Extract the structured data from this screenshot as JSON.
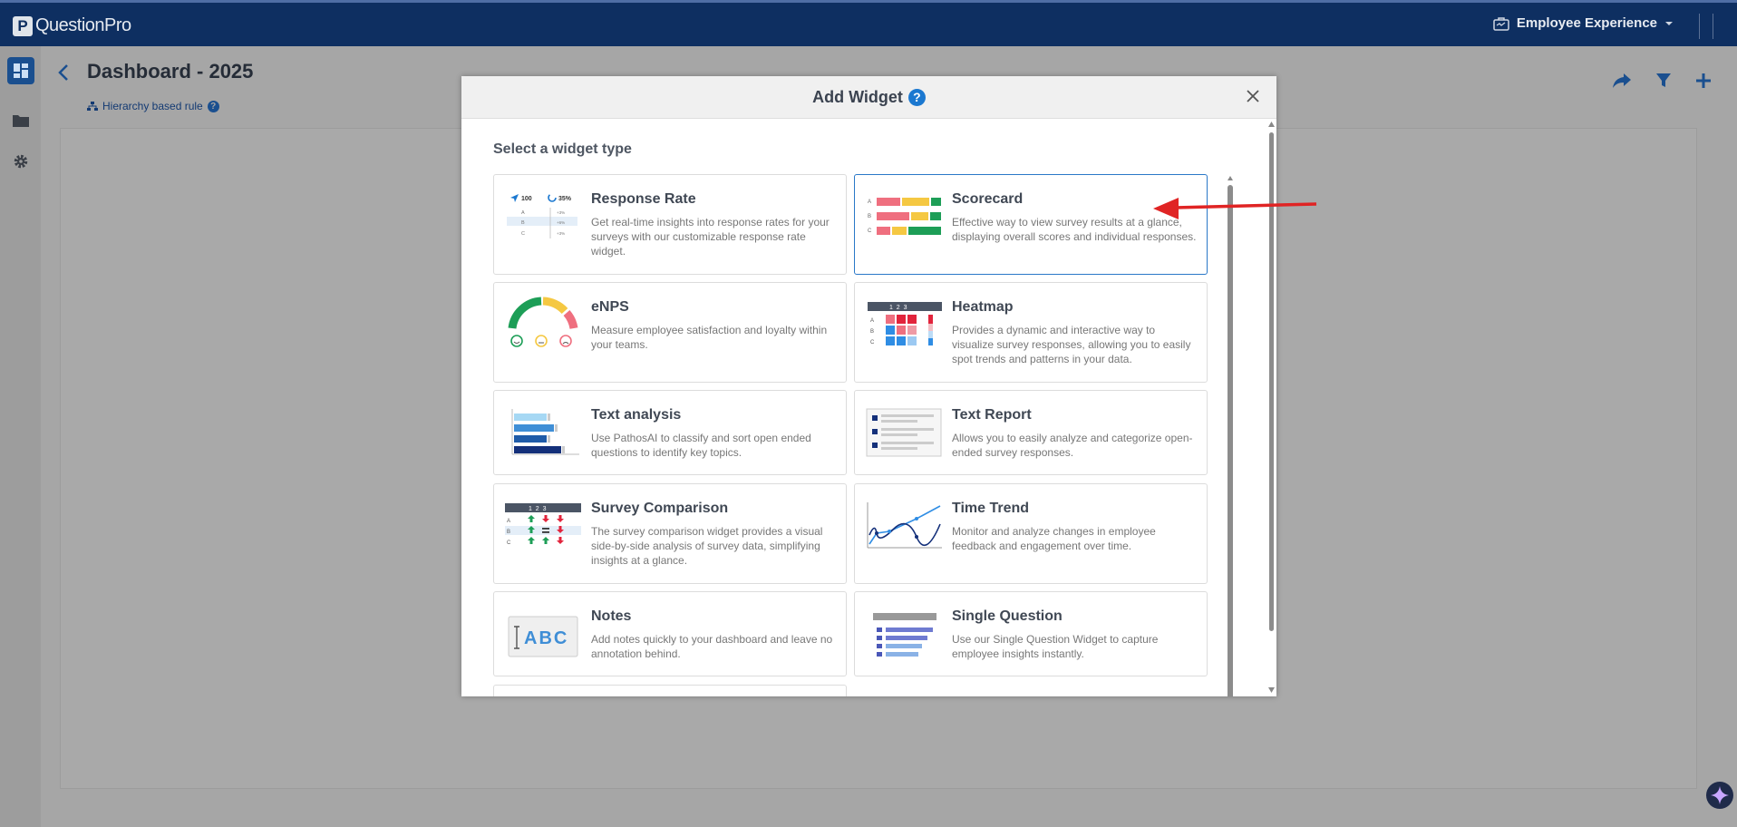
{
  "app": {
    "logo_text": "QuestionPro",
    "product": "Employee Experience"
  },
  "page": {
    "title": "Dashboard - 2025",
    "rule_label": "Hierarchy based rule"
  },
  "modal": {
    "title": "Add Widget",
    "section_label": "Select a widget type",
    "widgets": [
      {
        "title": "Response Rate",
        "desc": "Get real-time insights into response rates for your surveys with our customizable response rate widget.",
        "selected": false
      },
      {
        "title": "Scorecard",
        "desc": "Effective way to view survey results at a glance, displaying overall scores and individual responses.",
        "selected": true
      },
      {
        "title": "eNPS",
        "desc": "Measure employee satisfaction and loyalty within your teams.",
        "selected": false
      },
      {
        "title": "Heatmap",
        "desc": "Provides a dynamic and interactive way to visualize survey responses, allowing you to easily spot trends and patterns in your data.",
        "selected": false
      },
      {
        "title": "Text analysis",
        "desc": "Use PathosAI to classify and sort open ended questions to identify key topics.",
        "selected": false
      },
      {
        "title": "Text Report",
        "desc": "Allows you to easily analyze and categorize open-ended survey responses.",
        "selected": false
      },
      {
        "title": "Survey Comparison",
        "desc": "The survey comparison widget provides a visual side-by-side analysis of survey data, simplifying insights at a glance.",
        "selected": false
      },
      {
        "title": "Time Trend",
        "desc": "Monitor and analyze changes in employee feedback and engagement over time.",
        "selected": false
      },
      {
        "title": "Notes",
        "desc": "Add notes quickly to your dashboard and leave no annotation behind.",
        "selected": false
      },
      {
        "title": "Single Question",
        "desc": "Use our Single Question Widget to capture employee insights instantly.",
        "selected": false
      }
    ],
    "thumb_text": {
      "rr_count": "100",
      "rr_pct": "35%",
      "rr_rows": [
        "A",
        "B",
        "C"
      ],
      "rr_vals": [
        "+3%",
        "+6%",
        "+3%"
      ],
      "score_rows": [
        "A",
        "B",
        "C"
      ],
      "heat_cols": "1  2  3",
      "heat_rows": [
        "A",
        "B",
        "C"
      ],
      "comp_cols": "1  2  3",
      "comp_rows": [
        "A",
        "B",
        "C"
      ],
      "notes_text": "ABC"
    }
  },
  "colors": {
    "topbar": "#0e2f61",
    "accent": "#1b78d0",
    "selected_border": "#2a78c8",
    "annotation_arrow": "#e02424"
  }
}
